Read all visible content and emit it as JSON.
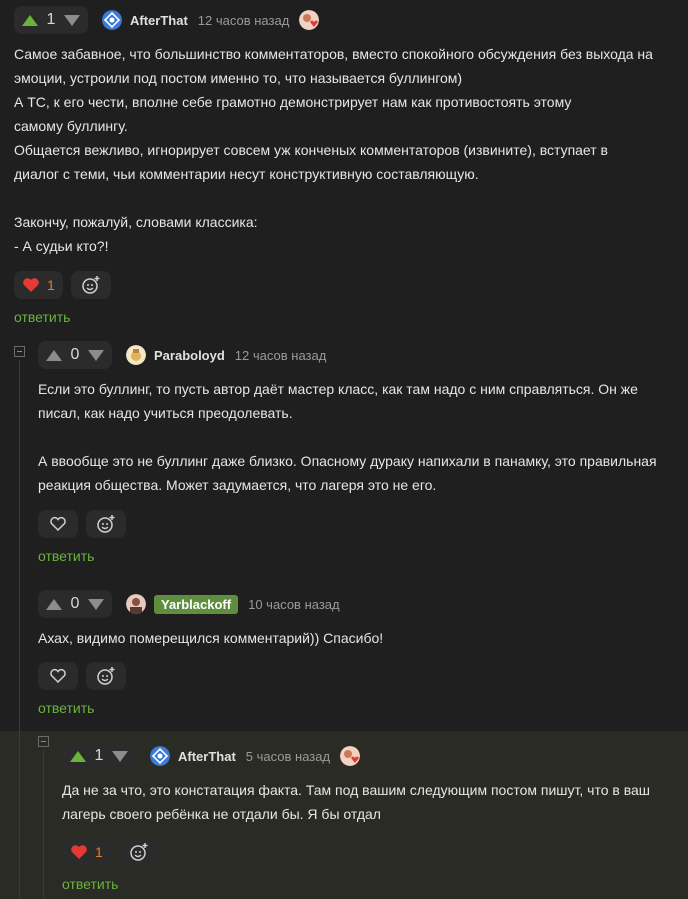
{
  "comments": [
    {
      "score": "1",
      "nick": "AfterThat",
      "time": "12 часов назад",
      "text": "Самое забавное, что большинство комментаторов, вместо спокойного обсуждения без выхода на\nэмоции, устроили под постом именно то, что называется буллингом)\nА ТС, к его чести, вполне себе грамотно демонстрирует нам как противостоять этому\nсамому буллингу.\nОбщается вежливо, игнорирует совсем уж конченых комментаторов (извините), вступает в\nдиалог с теми, чьи комментарии несут конструктивную составляющую.\n\nЗакончу, пожалуй, словами классика:\n- А судьи кто?!",
      "likes": "1",
      "reply": "ответить"
    },
    {
      "score": "0",
      "nick": "Paraboloyd",
      "time": "12 часов назад",
      "text": "Если это буллинг, то пусть автор даёт мастер класс, как там надо с ним справляться. Он же\nписал, как надо учиться преодолевать.\n\nА ввообще это не буллинг даже близко. Опасному дураку напихали в панамку, это правильная\nреакция общества. Может задумается, что лагеря это не его.",
      "reply": "ответить"
    },
    {
      "score": "0",
      "nick": "Yarblackoff",
      "time": "10 часов назад",
      "text": "Ахах, видимо померещился комментарий)) Спасибо!",
      "reply": "ответить"
    },
    {
      "score": "1",
      "nick": "AfterThat",
      "time": "5 часов назад",
      "text": "Да не за что, это констатация факта. Там под вашим следующим постом пишут, что в ваш\nлагерь своего ребёнка не отдали бы. Я бы отдал",
      "likes": "1",
      "reply": "ответить"
    }
  ],
  "colors": {
    "accent": "#6cb33e",
    "like": "#e53935",
    "background": "#1f1f1f",
    "highlight": "#2a2b24"
  }
}
